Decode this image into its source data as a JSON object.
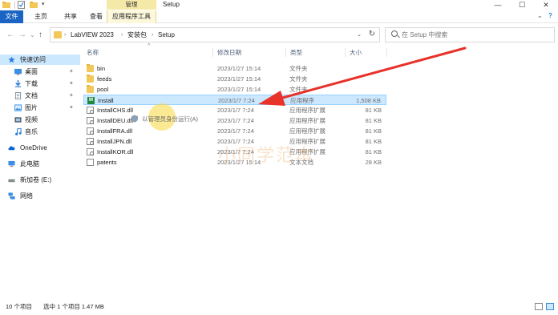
{
  "window": {
    "title": "Setup",
    "manage_tab": "管理",
    "controls": [
      "—",
      "☐",
      "✕"
    ]
  },
  "ribbon": {
    "tabs": [
      {
        "label": "文件",
        "id": "file"
      },
      {
        "label": "主页",
        "id": "home"
      },
      {
        "label": "共享",
        "id": "share"
      },
      {
        "label": "查看",
        "id": "view"
      },
      {
        "label": "应用程序工具",
        "id": "apptools"
      }
    ],
    "expand": "⌄",
    "help": "?"
  },
  "address": {
    "back": "←",
    "forward": "→",
    "recent": "⌄",
    "up": "↑",
    "breadcrumbs": [
      "LabVIEW 2023",
      "安装包",
      "Setup"
    ],
    "separator": "›",
    "dropdown": "⌄",
    "refresh": "↻"
  },
  "search": {
    "placeholder": "在 Setup 中搜索"
  },
  "sidebar": {
    "items": [
      {
        "label": "快速访问",
        "icon": "star-icon",
        "color": "#2b7cd3"
      },
      {
        "label": "桌面",
        "icon": "desktop-icon",
        "color": "#3a8ee6",
        "pinned": true
      },
      {
        "label": "下载",
        "icon": "download-icon",
        "color": "#2b7cd3",
        "pinned": true
      },
      {
        "label": "文档",
        "icon": "document-icon",
        "color": "#7a8a99",
        "pinned": true
      },
      {
        "label": "图片",
        "icon": "picture-icon",
        "color": "#3a8ee6",
        "pinned": true
      },
      {
        "label": "视频",
        "icon": "video-icon",
        "color": "#555555"
      },
      {
        "label": "音乐",
        "icon": "music-icon",
        "color": "#2b7cd3"
      },
      {
        "label": "OneDrive",
        "icon": "cloud-icon",
        "color": "#0a64d6"
      },
      {
        "label": "此电脑",
        "icon": "computer-icon",
        "color": "#3a8ee6"
      },
      {
        "label": "新加卷 (E:)",
        "icon": "drive-icon",
        "color": "#666666"
      },
      {
        "label": "网络",
        "icon": "network-icon",
        "color": "#3a8ee6"
      }
    ],
    "pin_glyph": "📌"
  },
  "columns": {
    "name": "名称",
    "date": "修改日期",
    "type": "类型",
    "size": "大小",
    "sort_glyph": "^"
  },
  "files": [
    {
      "name": "bin",
      "date": "2023/1/27 15:14",
      "type": "文件夹",
      "size": "",
      "icon": "folder-icon"
    },
    {
      "name": "feeds",
      "date": "2023/1/27 15:14",
      "type": "文件夹",
      "size": "",
      "icon": "folder-icon"
    },
    {
      "name": "pool",
      "date": "2023/1/27 15:14",
      "type": "文件夹",
      "size": "",
      "icon": "folder-icon"
    },
    {
      "name": "Install",
      "date": "2023/1/7 7:24",
      "type": "应用程序",
      "size": "1,508 KB",
      "icon": "labview-exe-icon",
      "selected": true
    },
    {
      "name": "InstallCHS.dll",
      "date": "2023/1/7 7:24",
      "type": "应用程序扩展",
      "size": "81 KB",
      "icon": "dll-icon"
    },
    {
      "name": "InstallDEU.dll",
      "date": "2023/1/7 7:24",
      "type": "应用程序扩展",
      "size": "81 KB",
      "icon": "dll-icon"
    },
    {
      "name": "InstallFRA.dll",
      "date": "2023/1/7 7:24",
      "type": "应用程序扩展",
      "size": "81 KB",
      "icon": "dll-icon"
    },
    {
      "name": "InstallJPN.dll",
      "date": "2023/1/7 7:24",
      "type": "应用程序扩展",
      "size": "81 KB",
      "icon": "dll-icon"
    },
    {
      "name": "InstallKOR.dll",
      "date": "2023/1/7 7:24",
      "type": "应用程序扩展",
      "size": "81 KB",
      "icon": "dll-icon"
    },
    {
      "name": "patents",
      "date": "2023/1/27 15:14",
      "type": "文本文档",
      "size": "28 KB",
      "icon": "text-file-icon"
    }
  ],
  "overlay": {
    "tooltip": "以管理员身份运行(A)",
    "watermark": "小同学范本",
    "arrow_color": "#e8322a",
    "highlight_color": "#f8d33a"
  },
  "status": {
    "count": "10 个项目",
    "selection": "选中 1 个项目  1.47 MB"
  },
  "colors": {
    "accent": "#1a64c4",
    "selection_bg": "#cce8ff",
    "manage_tab_bg": "#f5e9a8",
    "folder": "#f3c85a"
  }
}
